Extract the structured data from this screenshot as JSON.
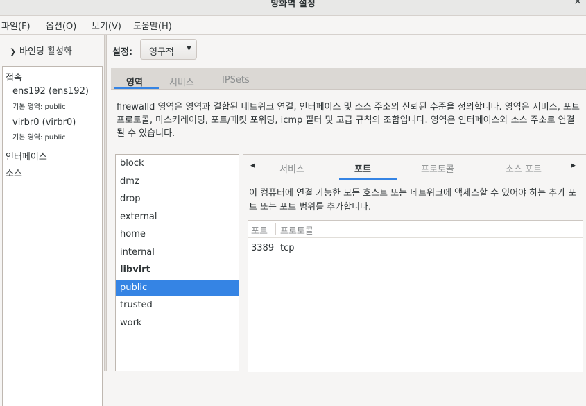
{
  "window": {
    "title": "방화벽 설정",
    "close": "×"
  },
  "menu": {
    "file": "파일(F)",
    "options": "옵션(O)",
    "view": "보기(V)",
    "help": "도움말(H)"
  },
  "binding": {
    "toggle_icon": "chevron-down-icon",
    "label": "바인딩 활성화"
  },
  "left_panel": {
    "connections_header": "접속",
    "connections": [
      {
        "name": "ens192 (ens192)",
        "zone": "기본 영역: public"
      },
      {
        "name": "virbr0 (virbr0)",
        "zone": "기본 영역: public"
      }
    ],
    "interfaces_header": "인터페이스",
    "sources_header": "소스"
  },
  "settings": {
    "label": "설정:",
    "value": "영구적"
  },
  "outer_tabs": {
    "zones": "영역",
    "services": "서비스",
    "ipsets": "IPSets",
    "active": "영역"
  },
  "zone_description": "firewalld 영역은 영역과 결합된 네트워크 연결, 인터페이스 및 소스 주소의 신뢰된 수준을 정의합니다. 영역은 서비스, 포트 프로토콜, 마스커레이딩, 포트/패킷 포워딩, icmp 필터 및 고급 규칙의 조합입니다. 영역은 인터페이스와 소스 주소로 연결될 수 있습니다.",
  "zones": [
    "block",
    "dmz",
    "drop",
    "external",
    "home",
    "internal",
    "libvirt",
    "public",
    "trusted",
    "work"
  ],
  "selected_zone": "public",
  "bold_zone": "libvirt",
  "inner_tabs": {
    "services": "서비스",
    "ports": "포트",
    "protocols": "프로토콜",
    "source_ports": "소스 포트",
    "active": "포트"
  },
  "ports_description": "이 컴퓨터에 연결 가능한 모든 호스트 또는 네트워크에 액세스할 수 있어야 하는 추가 포트 또는 포트 범위를 추가합니다.",
  "ports_table": {
    "columns": [
      "포트",
      "프로토콜"
    ],
    "rows": [
      {
        "port": "3389",
        "protocol": "tcp"
      }
    ]
  },
  "colors": {
    "accent": "#3584e4",
    "bg": "#f6f5f4",
    "tab_strip": "#dbd8d4"
  }
}
